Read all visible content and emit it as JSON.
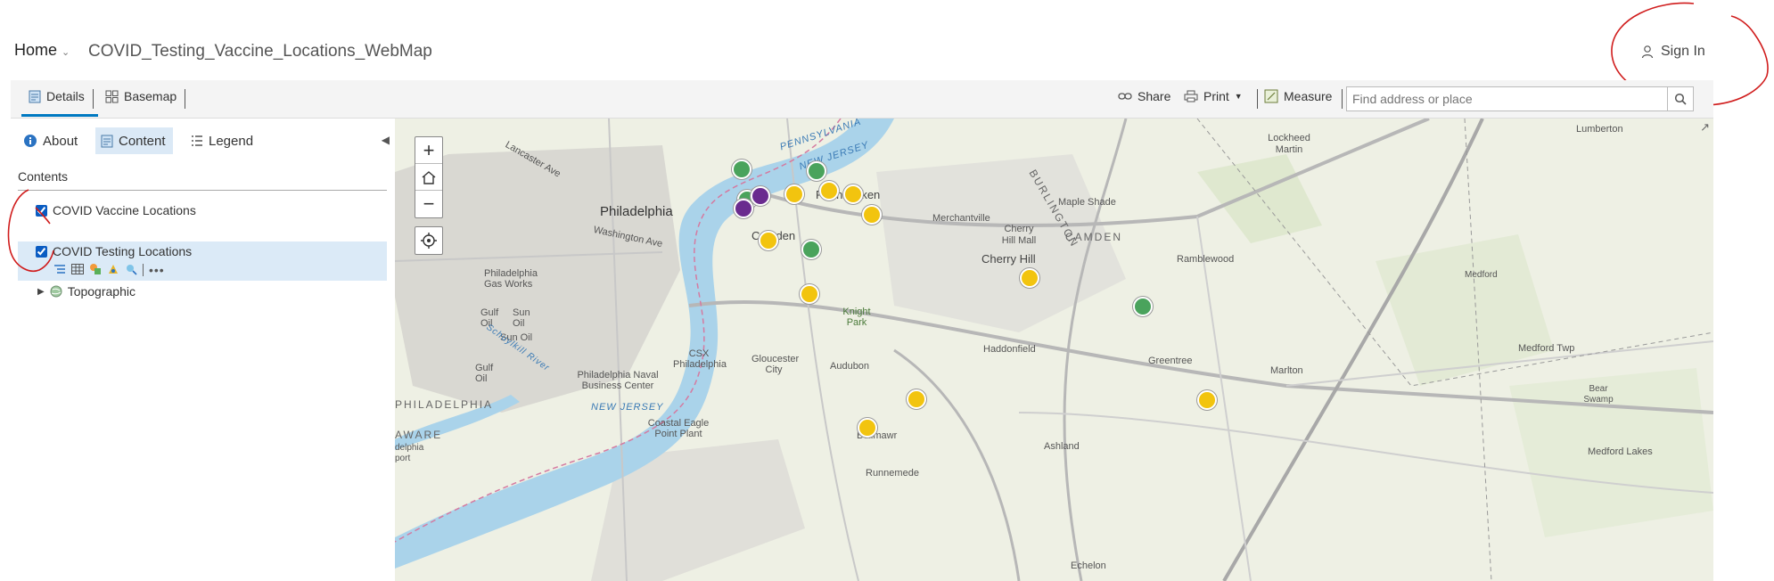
{
  "header": {
    "home_label": "Home",
    "map_title": "COVID_Testing_Vaccine_Locations_WebMap",
    "signin_label": "Sign In"
  },
  "toolbar": {
    "details_label": "Details",
    "basemap_label": "Basemap",
    "share_label": "Share",
    "print_label": "Print",
    "measure_label": "Measure",
    "search_placeholder": "Find address or place"
  },
  "panel": {
    "tabs": [
      {
        "label": "About"
      },
      {
        "label": "Content"
      },
      {
        "label": "Legend"
      }
    ],
    "contents_label": "Contents",
    "layers": [
      {
        "name": "COVID Vaccine Locations",
        "checked": true
      },
      {
        "name": "COVID Testing Locations",
        "checked": true
      },
      {
        "name": "Topographic"
      }
    ]
  },
  "map": {
    "labels": {
      "philadelphia": "Philadelphia",
      "camden": "Camden",
      "pennsauken": "Pennsauken",
      "merchantville": "Merchantville",
      "burlington": "BURLINGTON",
      "maple_shade": "Maple Shade",
      "lockheed": "Lockheed Martin",
      "lumberton": "Lumberton",
      "pennsylvania": "PENNSYLVANIA",
      "new_jersey_n": "NEW JERSEY",
      "new_jersey_s": "NEW JERSEY",
      "washington_ave": "Washington Ave",
      "lancaster_ave": "Lancaster Ave",
      "cherry_hill_mall": "Cherry Hill Mall",
      "camden_county": "CAMDEN",
      "cherry_hill": "Cherry Hill",
      "ramblewood": "Ramblewood",
      "medford": "Medford",
      "phila_gas": "Philadelphia Gas Works",
      "gulf_oil_1": "Gulf Oil",
      "sun_oil_1": "Sun Oil",
      "sun_oil_2": "Sun Oil",
      "gulf_oil_2": "Gulf Oil",
      "knight_park": "Knight Park",
      "haddonfield": "Haddonfield",
      "greentree": "Greentree",
      "marlton": "Marlton",
      "medford_twp": "Medford Twp",
      "csx": "CSX Philadelphia",
      "gloucester": "Gloucester City",
      "audubon": "Audubon",
      "phila_naval": "Philadelphia Naval Business Center",
      "bear_swamp": "Bear Swamp",
      "schuylkill": "Schuylkill River",
      "philadelphia_county": "PHILADELPHIA",
      "delaware": "AWARE",
      "coastal_eagle": "Coastal Eagle Point Plant",
      "bellmawr": "Bellmawr",
      "ashland": "Ashland",
      "medford_lakes": "Medford Lakes",
      "runnemede": "Runnemede",
      "echelon": "Echelon",
      "delphia_port": "delphia port"
    }
  }
}
